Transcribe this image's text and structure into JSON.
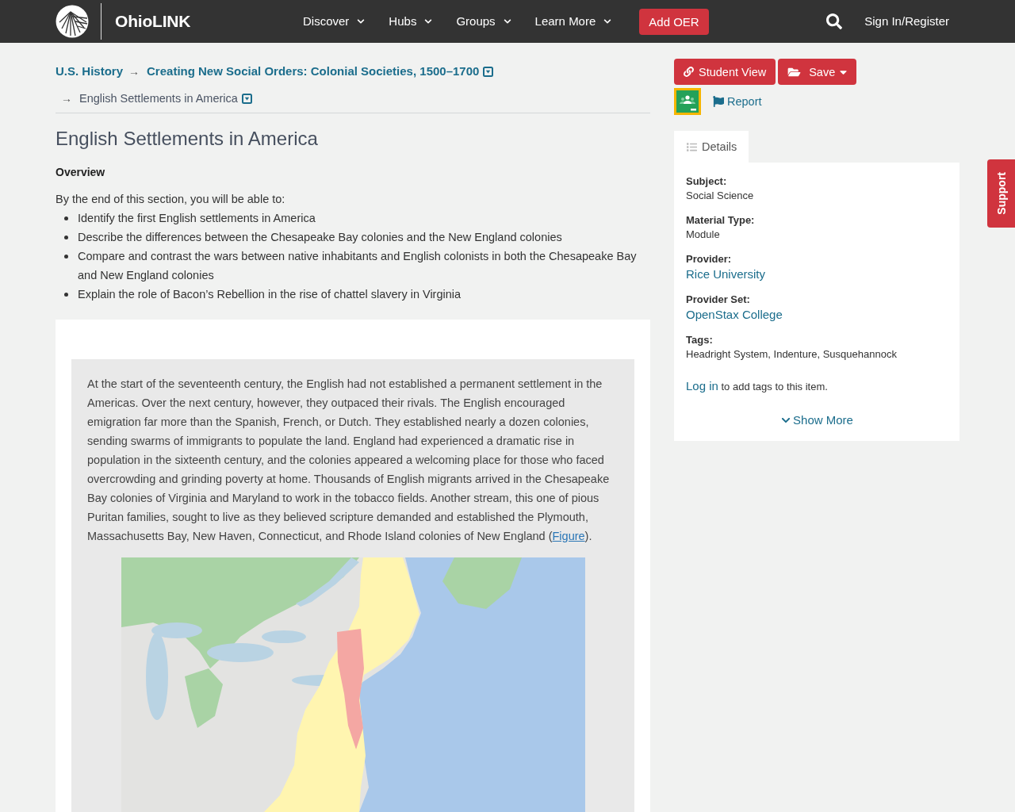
{
  "header": {
    "logo": "OhioLINK",
    "nav": [
      {
        "label": "Discover",
        "menu": true
      },
      {
        "label": "Hubs",
        "menu": true
      },
      {
        "label": "Groups",
        "menu": true
      },
      {
        "label": "Learn More",
        "menu": true
      }
    ],
    "add_button": "Add OER",
    "sign_in": "Sign In/Register"
  },
  "breadcrumb": [
    {
      "label": "U.S. History",
      "kind": "link",
      "menu": false
    },
    {
      "separator": "→",
      "label": "Creating New Social Orders: Colonial Societies, 1500–1700",
      "kind": "link",
      "menu": true
    },
    {
      "separator": "→",
      "label": "English Settlements in America",
      "kind": "current",
      "menu": true
    }
  ],
  "article": {
    "title": "English Settlements in America",
    "overview": {
      "heading": "Overview",
      "intro": "By the end of this section, you will be able to:",
      "objectives": [
        "Identify the first English settlements in America",
        "Describe the differences between the Chesapeake Bay colonies and the New England colonies",
        "Compare and contrast the wars between native inhabitants and English colonists in both the Chesapeake Bay and New England colonies",
        "Explain the role of Bacon’s Rebellion in the rise of chattel slavery in Virginia"
      ]
    },
    "paragraph": {
      "text": "At the start of the seventeenth century, the English had not established a permanent settlement in the Americas. Over the next century, however, they outpaced their rivals. The English encouraged emigration far more than the Spanish, French, or Dutch. They established nearly a dozen colonies, sending swarms of immigrants to populate the land. England had experienced a dramatic rise in population in the sixteenth century, and the colonies appeared a welcoming place for those who faced overcrowding and grinding poverty at home. Thousands of English migrants arrived in the Chesapeake Bay colonies of Virginia and Maryland to work in the tobacco fields. Another stream, this one of pious Puritan families, sought to live as they believed scripture demanded and established the Plymouth, Massachusetts Bay, New Haven, Connecticut, and Rhode Island colonies of New England (",
      "link": "Figure",
      "after": ")."
    }
  },
  "sidebar": {
    "buttons": [
      {
        "kind": "view",
        "label": "Student View",
        "menu": false
      },
      {
        "kind": "save",
        "label": "Save",
        "menu": true
      }
    ],
    "report": "Report",
    "tabs": [
      {
        "label": "Details",
        "selected": true
      }
    ],
    "fields": [
      {
        "label": "Subject:",
        "value": "Social Science",
        "kind": "text"
      },
      {
        "label": "Material Type:",
        "value": "Module",
        "kind": "text"
      },
      {
        "label": "Provider:",
        "value": "Rice University",
        "kind": "link"
      },
      {
        "label": "Provider Set:",
        "value": "OpenStax College",
        "kind": "link"
      },
      {
        "label": "Tags:",
        "value": "Headright System, Indenture, Susquehannock",
        "kind": "text"
      }
    ],
    "tags_note": {
      "link": "Log in",
      "text": " to add tags to this item."
    },
    "show_more": "Show More"
  },
  "support": "Support"
}
